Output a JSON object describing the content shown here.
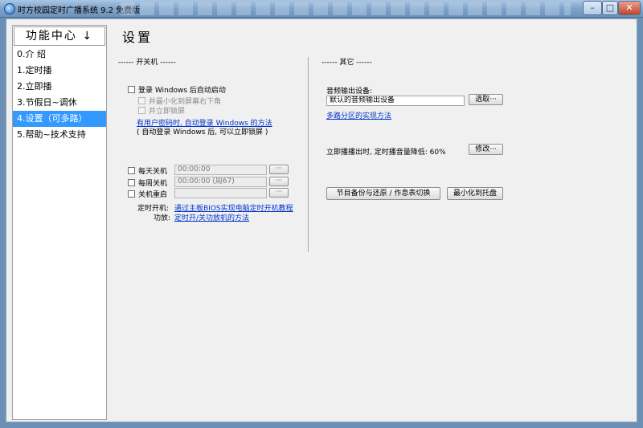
{
  "window": {
    "title": "时方校园定时广播系统 9.2 免费版",
    "minimize_glyph": "–",
    "maximize_glyph": "□",
    "close_glyph": "✕"
  },
  "sidebar": {
    "header": "功能中心",
    "header_icon": "↓",
    "items": [
      {
        "label": "0.介 绍"
      },
      {
        "label": "1.定时播"
      },
      {
        "label": "2.立即播"
      },
      {
        "label": "3.节假日~调休"
      },
      {
        "label": "4.设置（可多路）",
        "active": true
      },
      {
        "label": "5.帮助~技术支持"
      }
    ]
  },
  "page": {
    "title": "设置"
  },
  "power": {
    "section_label": "------  开关机  ------",
    "auto_login": {
      "label": "登录 Windows 后自动启动",
      "checked": false
    },
    "minimize_tray": {
      "label": "并最小化到屏幕右下角",
      "checked": false
    },
    "lock_screen": {
      "label": "并立即锁屏",
      "checked": false
    },
    "password_link": "有用户密码时, 自动登录 Windows 的方法",
    "password_note": "( 自动登录 Windows 后, 可以立即锁屏 )",
    "daily_shutdown": {
      "label": "每天关机",
      "value": "00:00:00",
      "button": "···"
    },
    "weekly_shutdown": {
      "label": "每周关机",
      "value": "00:00:00 (周67)",
      "button": "···"
    },
    "reboot": {
      "label": "关机重启",
      "value": "",
      "button": "···"
    },
    "timed_boot_label": "定时开机:",
    "timed_boot_link": "通过主板BIOS实现电脑定时开机教程",
    "function_label": "功放:",
    "function_link": "定时开/关功放机的方法"
  },
  "other": {
    "section_label": "------  其它  ------",
    "audio_device_label": "音频输出设备:",
    "audio_device_value": "默认的音频输出设备",
    "select_button": "选取···",
    "multi_zone_link": "多路分区的实现方法",
    "volume_drop_text": "立即播播出时, 定时播音量降低: 60%",
    "modify_button": "修改···",
    "backup_button": "节目备份与还原 / 作息表切换",
    "minimize_tray_button": "最小化到托盘"
  }
}
